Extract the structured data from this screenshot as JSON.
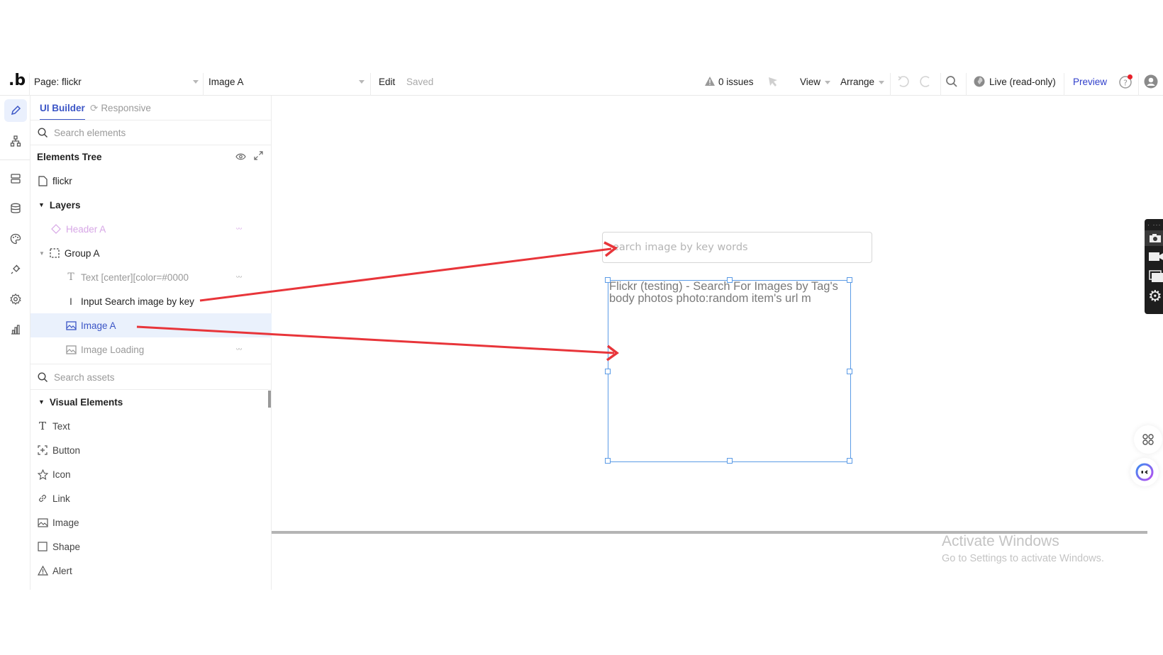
{
  "topbar": {
    "logo": ".b",
    "page_selector": "Page: flickr",
    "element_selector": "Image A",
    "edit_label": "Edit",
    "saved_label": "Saved",
    "issues_label": "0 issues",
    "view_label": "View",
    "arrange_label": "Arrange",
    "live_label": "Live (read-only)",
    "preview_label": "Preview",
    "notification_color": "#e8202a",
    "preview_color": "#2f3ecb"
  },
  "panel": {
    "tabs": [
      {
        "label": "UI Builder",
        "active": true
      },
      {
        "label": "Responsive",
        "active": false
      }
    ],
    "search_elements_placeholder": "Search elements",
    "elements_tree_title": "Elements Tree",
    "tree": {
      "page": "flickr",
      "layers_label": "Layers",
      "items": [
        {
          "label": "Header A",
          "type": "header",
          "hidden": true
        },
        {
          "label": "Group A",
          "type": "group",
          "hidden": false
        },
        {
          "label": "Text [center][color=#0000",
          "type": "text",
          "hidden": true
        },
        {
          "label": "Input Search image by key",
          "type": "input",
          "hidden": false
        },
        {
          "label": "Image A",
          "type": "image",
          "hidden": false,
          "selected": true
        },
        {
          "label": "Image Loading",
          "type": "image",
          "hidden": true
        }
      ]
    },
    "search_assets_placeholder": "Search assets",
    "visual_elements_label": "Visual Elements",
    "visual_elements": [
      {
        "label": "Text",
        "icon": "text-icon"
      },
      {
        "label": "Button",
        "icon": "button-icon"
      },
      {
        "label": "Icon",
        "icon": "star-icon"
      },
      {
        "label": "Link",
        "icon": "link-icon"
      },
      {
        "label": "Image",
        "icon": "image-icon"
      },
      {
        "label": "Shape",
        "icon": "shape-icon"
      },
      {
        "label": "Alert",
        "icon": "alert-icon"
      }
    ]
  },
  "canvas": {
    "search_input_placeholder": "earch image  by key words",
    "image_text": "Flickr (testing) - Search For Images by Tag's body photos photo:random item's url  m",
    "selection_color": "#5b9be6",
    "annotation_color": "#e8353a"
  },
  "watermark": {
    "line1": "Activate Windows",
    "line2": "Go to Settings to activate Windows."
  }
}
